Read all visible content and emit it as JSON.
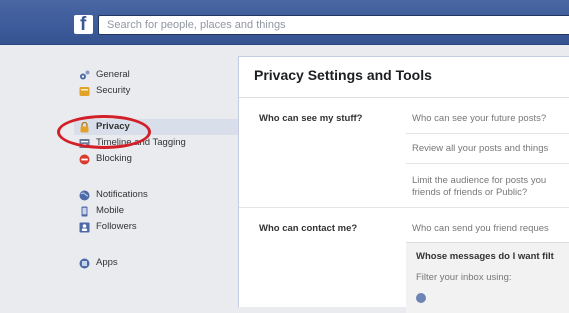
{
  "topbar": {
    "logo_letter": "f",
    "search_placeholder": "Search for people, places and things"
  },
  "sidebar": {
    "items": [
      {
        "label": "General",
        "icon": "gear-icon"
      },
      {
        "label": "Security",
        "icon": "badge-icon"
      },
      {
        "label": "Privacy",
        "icon": "lock-icon"
      },
      {
        "label": "Timeline and Tagging",
        "icon": "timeline-icon"
      },
      {
        "label": "Blocking",
        "icon": "block-icon"
      },
      {
        "label": "Notifications",
        "icon": "globe-icon"
      },
      {
        "label": "Mobile",
        "icon": "mobile-icon"
      },
      {
        "label": "Followers",
        "icon": "followers-icon"
      },
      {
        "label": "Apps",
        "icon": "apps-icon"
      }
    ]
  },
  "main": {
    "title": "Privacy Settings and Tools",
    "sections": [
      {
        "label": "Who can see my stuff?",
        "rows": [
          "Who can see your future posts?",
          "Review all your posts and things",
          "Limit the audience for posts you\nfriends of friends or Public?"
        ]
      },
      {
        "label": "Who can contact me?",
        "rows": [
          "Who can send you friend reques"
        ]
      }
    ],
    "sub_panel": {
      "title": "Whose messages do I want filt",
      "text": "Filter your inbox using:"
    }
  },
  "colors": {
    "brand_blue": "#3b5998",
    "highlight_red": "#d21f28"
  }
}
